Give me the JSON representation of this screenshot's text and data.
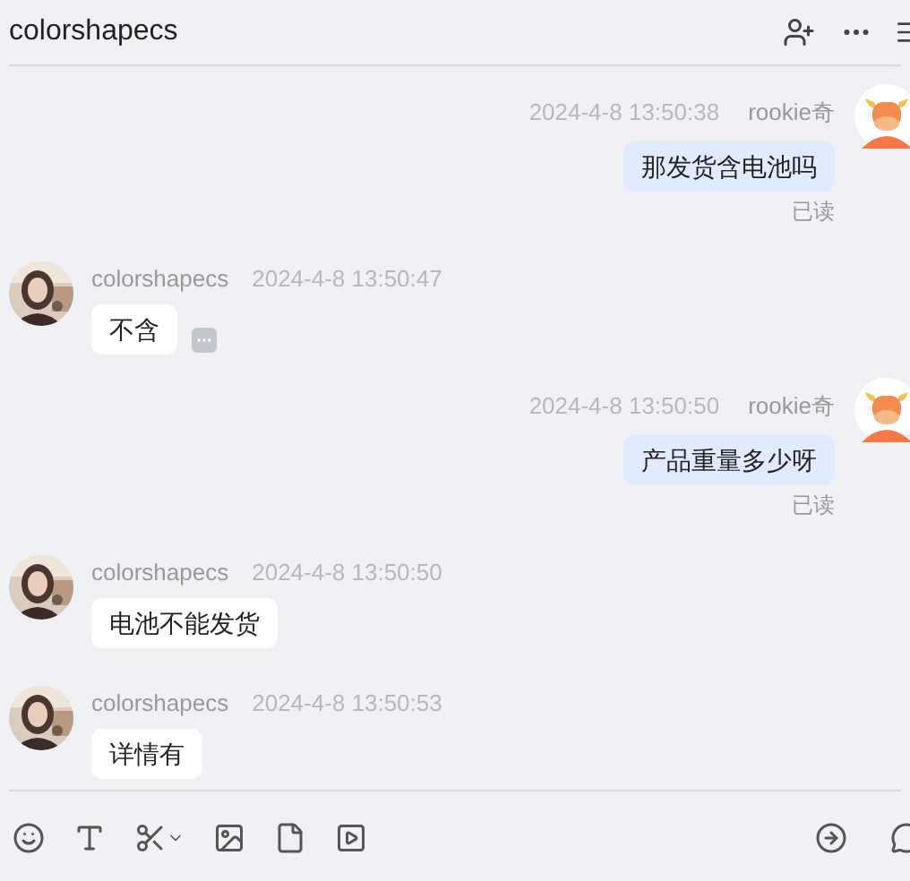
{
  "header": {
    "title": "colorshapecs"
  },
  "messages": [
    {
      "kind": "outgoing",
      "sender": "rookie奇",
      "time": "2024-4-8 13:50:38",
      "text": "那发货含电池吗",
      "status": "已读",
      "more_button": false
    },
    {
      "kind": "incoming",
      "sender": "colorshapecs",
      "time": "2024-4-8 13:50:47",
      "text": "不含",
      "more_button": true
    },
    {
      "kind": "outgoing",
      "sender": "rookie奇",
      "time": "2024-4-8 13:50:50",
      "text": "产品重量多少呀",
      "status": "已读",
      "more_button": false
    },
    {
      "kind": "incoming",
      "sender": "colorshapecs",
      "time": "2024-4-8 13:50:50",
      "text": "电池不能发货",
      "more_button": false
    },
    {
      "kind": "incoming",
      "sender": "colorshapecs",
      "time": "2024-4-8 13:50:53",
      "text": "详情有",
      "more_button": false
    }
  ]
}
